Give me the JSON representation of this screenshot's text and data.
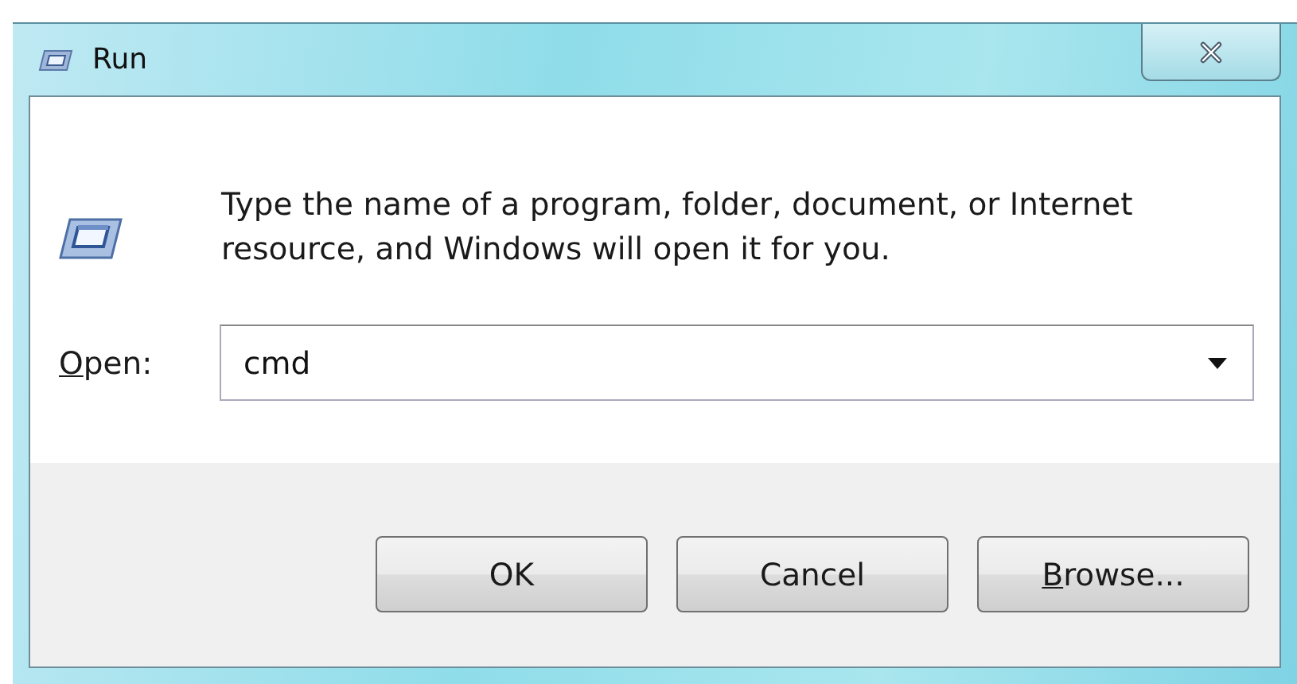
{
  "window": {
    "title": "Run"
  },
  "message": "Type the name of a program, folder, document, or Internet resource, and Windows will open it for you.",
  "open_field": {
    "label_mnemonic": "O",
    "label_rest": "pen:",
    "value": "cmd"
  },
  "buttons": [
    {
      "rest": "OK"
    },
    {
      "rest": "Cancel"
    },
    {
      "mnemonic": "B",
      "rest": "rowse..."
    }
  ]
}
